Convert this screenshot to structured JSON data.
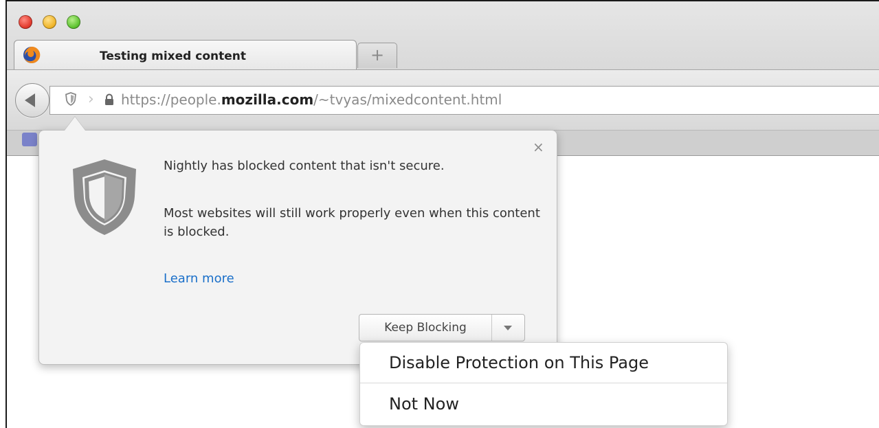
{
  "window": {
    "controls": [
      "close",
      "minimize",
      "zoom"
    ]
  },
  "tab": {
    "title": "Testing mixed content",
    "favicon": "firefox-icon"
  },
  "new_tab_label": "+",
  "url": {
    "scheme_and_sub": "https://people.",
    "domain": "mozilla.com",
    "path": "/~tvyas/mixedcontent.html"
  },
  "panel": {
    "message": "Nightly has blocked content that isn't secure.",
    "detail": "Most websites will still work properly even when this content is blocked.",
    "learn_more": "Learn more",
    "close_label": "×",
    "button_label": "Keep Blocking"
  },
  "menu": {
    "items": [
      "Disable Protection on This Page",
      "Not Now"
    ]
  },
  "colors": {
    "link": "#1a6fc9",
    "shield": "#8c8c8c"
  }
}
